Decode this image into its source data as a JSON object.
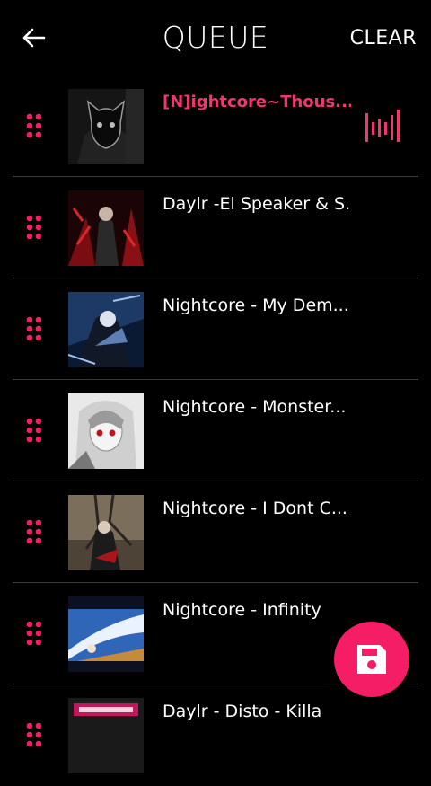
{
  "header": {
    "title": "QUEUE",
    "clear_label": "CLEAR",
    "back_icon": "arrow-left-icon"
  },
  "accent_color": "#f51e66",
  "queue": [
    {
      "title": "[N]ightcore~Thous...",
      "active": true
    },
    {
      "title": "Daylr -El Speaker & S...",
      "active": false
    },
    {
      "title": "Nightcore - My Dem...",
      "active": false
    },
    {
      "title": "Nightcore - Monster...",
      "active": false
    },
    {
      "title": "Nightcore - I Dont C...",
      "active": false
    },
    {
      "title": "Nightcore - Infinity",
      "active": false
    },
    {
      "title": "Daylr - Disto - Killa",
      "active": false
    }
  ],
  "fab": {
    "icon": "save-icon"
  },
  "row_icons": {
    "handle": "drag-handle-icon",
    "playing": "equalizer-icon"
  }
}
